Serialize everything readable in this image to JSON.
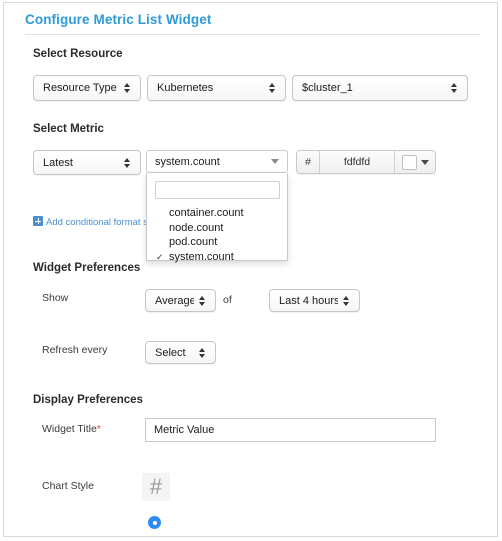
{
  "dialog": {
    "title": "Configure Metric List Widget"
  },
  "sections": {
    "resource": {
      "heading": "Select Resource",
      "selects": [
        {
          "name": "resource-type",
          "value": "Resource Type"
        },
        {
          "name": "resource-platform",
          "value": "Kubernetes"
        },
        {
          "name": "resource-cluster",
          "value": "$cluster_1"
        }
      ]
    },
    "metric": {
      "heading": "Select Metric",
      "aggregation": {
        "value": "Latest"
      },
      "metric_combo": {
        "value": "system.count",
        "search_value": "",
        "options": [
          {
            "label": "container.count",
            "selected": false
          },
          {
            "label": "node.count",
            "selected": false
          },
          {
            "label": "pod.count",
            "selected": false
          },
          {
            "label": "system.count",
            "selected": true
          }
        ],
        "check_glyph": "✓"
      },
      "color": {
        "hash_prefix": "#",
        "value": "fdfdfd",
        "swatch_hex": "#fdfdfd"
      },
      "conditional_link": "Add conditional format settings"
    },
    "widget_preferences": {
      "heading": "Widget Preferences",
      "show_label": "Show",
      "show_value": "Average",
      "of_text": "of",
      "range_value": "Last 4 hours",
      "refresh_label": "Refresh every",
      "refresh_value": "Select"
    },
    "display_preferences": {
      "heading": "Display Preferences",
      "widget_title_label": "Widget Title",
      "required_mark": "*",
      "widget_title_value": "Metric Value",
      "chart_style_label": "Chart Style",
      "chart_style_icon": "#"
    }
  },
  "colors": {
    "accent": "#2e9bd6",
    "radio_selected": "#2d8cf0",
    "required": "#e03a2f",
    "link": "#4a8fd0"
  }
}
